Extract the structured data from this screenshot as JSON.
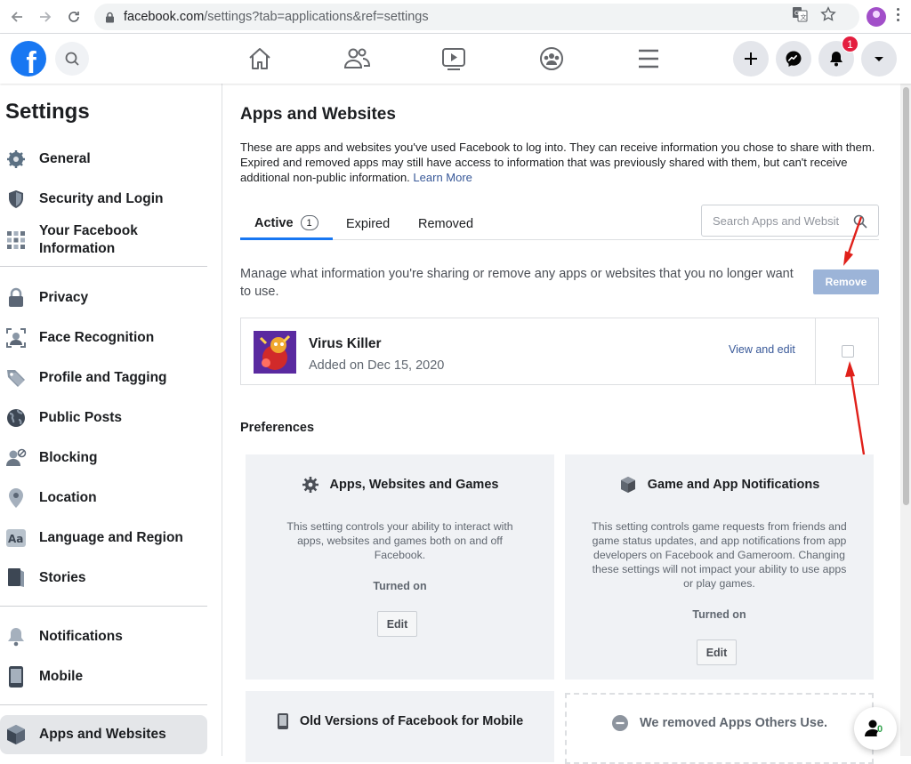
{
  "browser": {
    "url_host": "facebook.com",
    "url_rest": "/settings?tab=applications&ref=settings"
  },
  "header": {
    "logo_letter": "f",
    "notification_count": "1"
  },
  "sidebar": {
    "title": "Settings",
    "items": [
      {
        "label": "General",
        "icon": "gear-icon"
      },
      {
        "label": "Security and Login",
        "icon": "shield-icon"
      },
      {
        "label": "Your Facebook Information",
        "icon": "grid-icon"
      },
      {
        "label": "Privacy",
        "icon": "lock-icon"
      },
      {
        "label": "Face Recognition",
        "icon": "face-icon"
      },
      {
        "label": "Profile and Tagging",
        "icon": "tag-icon"
      },
      {
        "label": "Public Posts",
        "icon": "globe-icon"
      },
      {
        "label": "Blocking",
        "icon": "block-user-icon"
      },
      {
        "label": "Location",
        "icon": "pin-icon"
      },
      {
        "label": "Language and Region",
        "icon": "language-icon"
      },
      {
        "label": "Stories",
        "icon": "book-icon"
      },
      {
        "label": "Notifications",
        "icon": "bell-icon"
      },
      {
        "label": "Mobile",
        "icon": "phone-icon"
      },
      {
        "label": "Apps and Websites",
        "icon": "cube-icon"
      }
    ]
  },
  "main": {
    "title": "Apps and Websites",
    "description": "These are apps and websites you've used Facebook to log into. They can receive information you chose to share with them. Expired and removed apps may still have access to information that was previously shared with them, but can't receive additional non-public information.",
    "learn_more": "Learn More",
    "tabs": [
      {
        "label": "Active",
        "count": "1"
      },
      {
        "label": "Expired"
      },
      {
        "label": "Removed"
      }
    ],
    "search_placeholder": "Search Apps and Websit",
    "manage_text": "Manage what information you're sharing or remove any apps or websites that you no longer want to use.",
    "remove_label": "Remove",
    "apps": [
      {
        "name": "Virus Killer",
        "added": "Added on Dec 15, 2020",
        "action": "View and edit"
      }
    ],
    "preferences_title": "Preferences",
    "cards": [
      {
        "title": "Apps, Websites and Games",
        "icon": "gear-icon",
        "description": "This setting controls your ability to interact with apps, websites and games both on and off Facebook.",
        "status": "Turned on",
        "button": "Edit"
      },
      {
        "title": "Game and App Notifications",
        "icon": "box-icon",
        "description": "This setting controls game requests from friends and game status updates, and app notifications from app developers on Facebook and Gameroom. Changing these settings will not impact your ability to use apps or play games.",
        "status": "Turned on",
        "button": "Edit"
      },
      {
        "title": "Old Versions of Facebook for Mobile",
        "icon": "phone-icon"
      },
      {
        "title": "We removed Apps Others Use.",
        "icon": "minus-circle-icon"
      }
    ]
  },
  "floating": {
    "count": "0"
  }
}
